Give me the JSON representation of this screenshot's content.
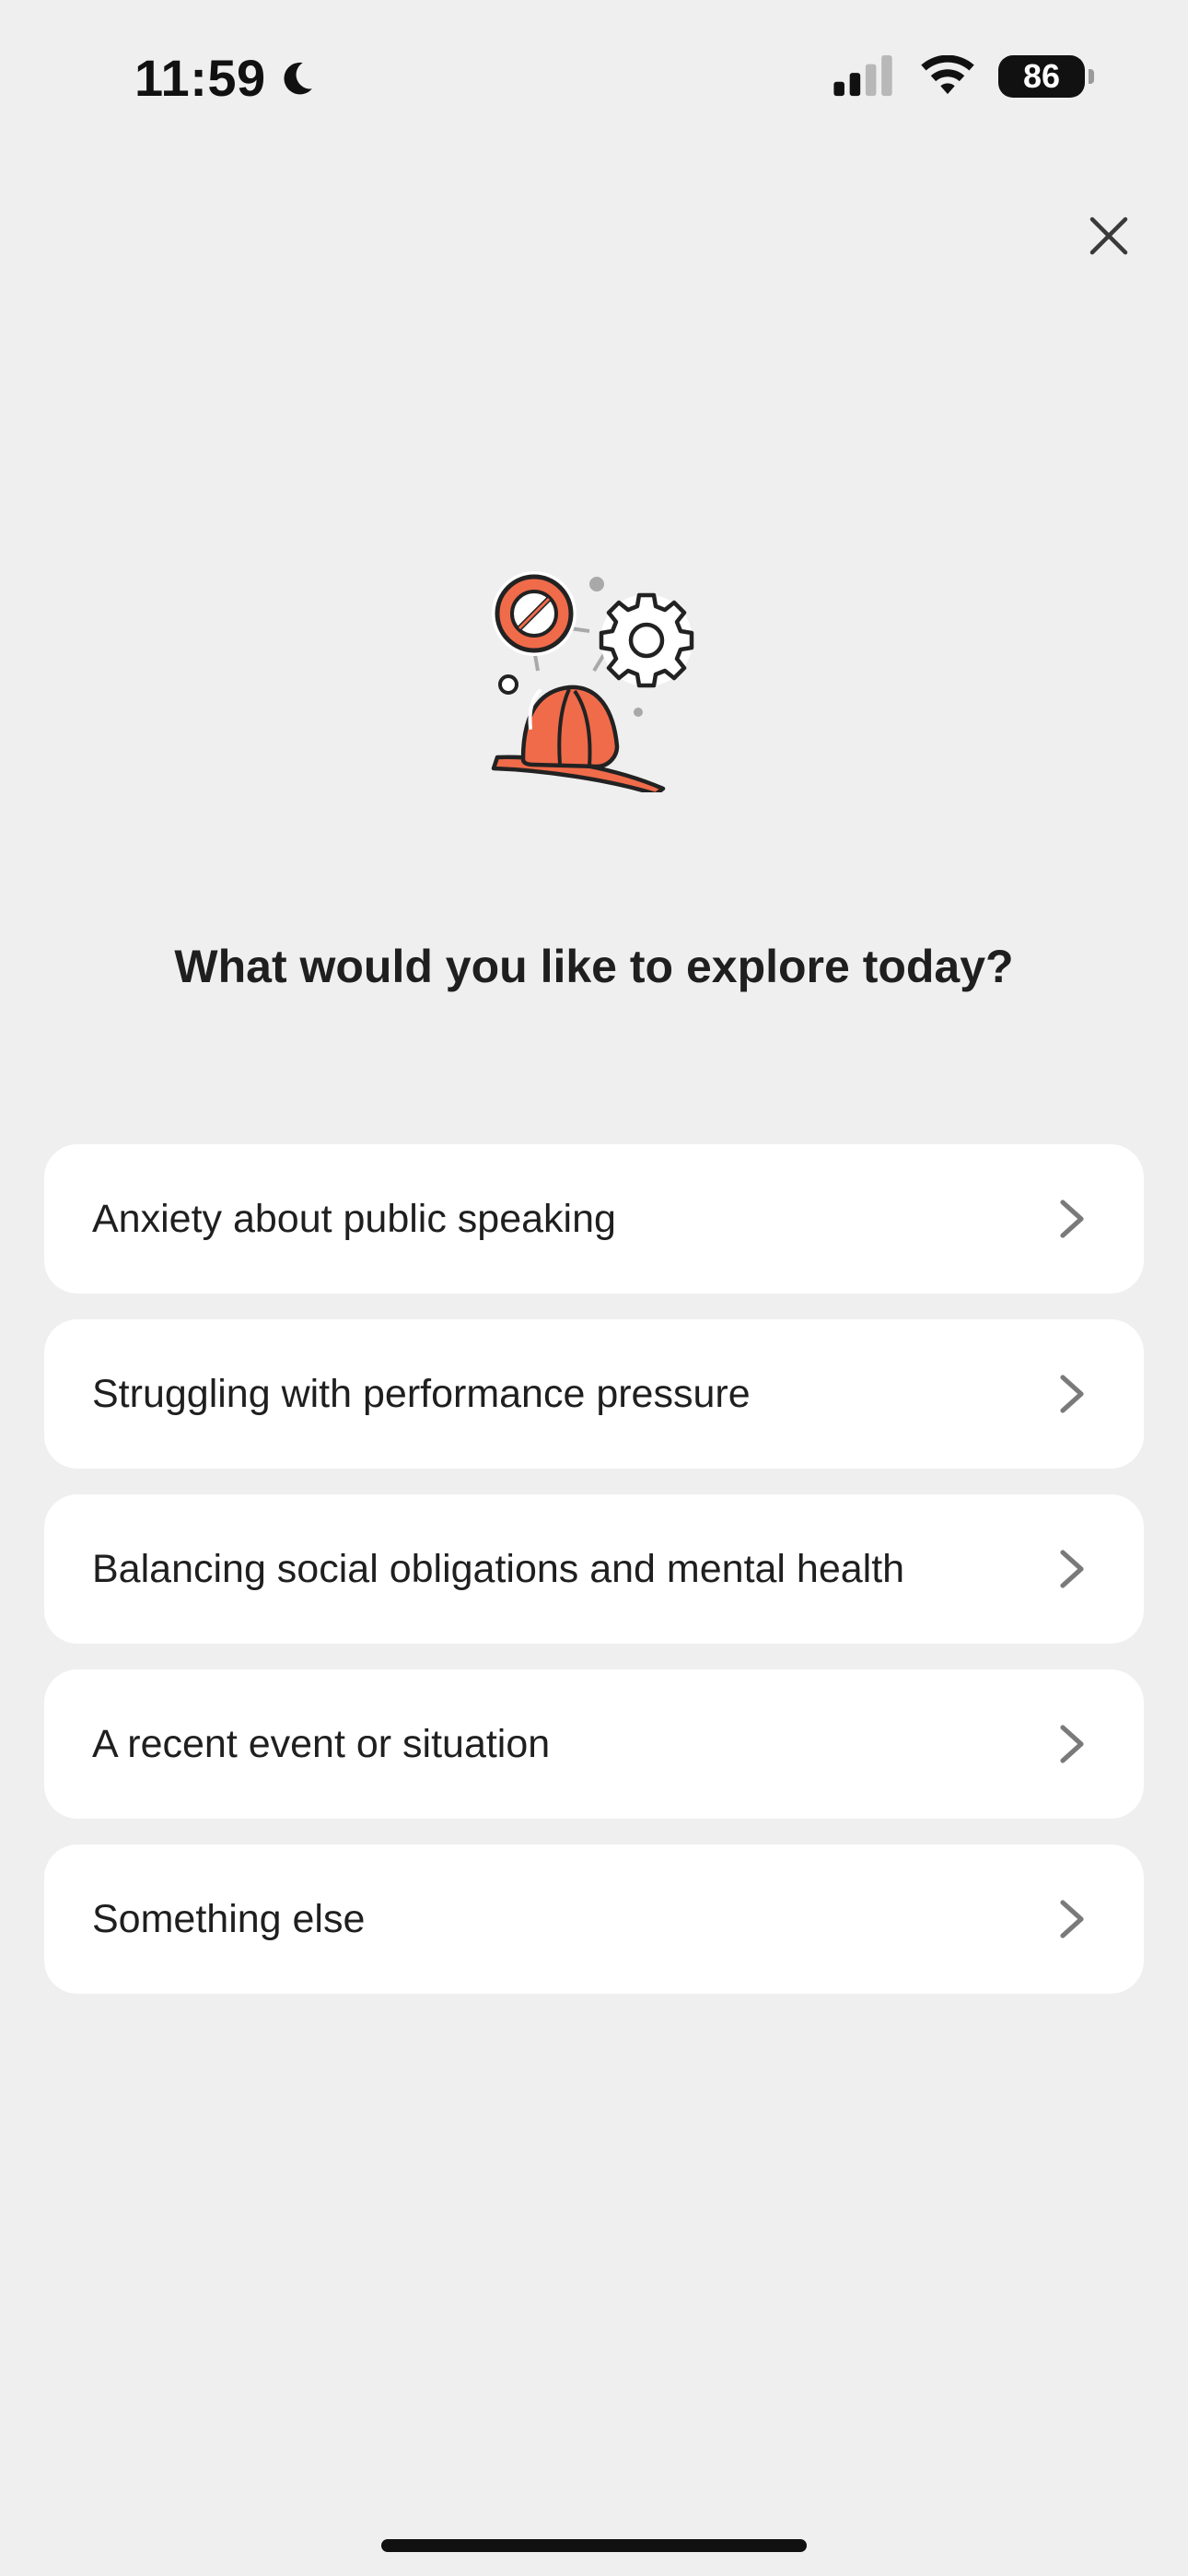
{
  "status_bar": {
    "time": "11:59",
    "battery": "86",
    "moon_icon": "moon-icon",
    "signal_icon": "cellular-signal-icon",
    "wifi_icon": "wifi-icon"
  },
  "header": {
    "close_icon": "close-icon"
  },
  "illustration": {
    "icon": "firefighter-helmet-gear-prohibited-illustration",
    "accent_color": "#f06b4a"
  },
  "main": {
    "title": "What would you like to explore today?",
    "options": [
      {
        "label": "Anxiety about public speaking"
      },
      {
        "label": "Struggling with performance pressure"
      },
      {
        "label": "Balancing social obligations and mental health"
      },
      {
        "label": "A recent event or situation"
      },
      {
        "label": "Something else"
      }
    ]
  },
  "colors": {
    "background": "#efefef",
    "card": "#ffffff",
    "text": "#1f1f1f",
    "chevron": "#7a7a7a"
  }
}
